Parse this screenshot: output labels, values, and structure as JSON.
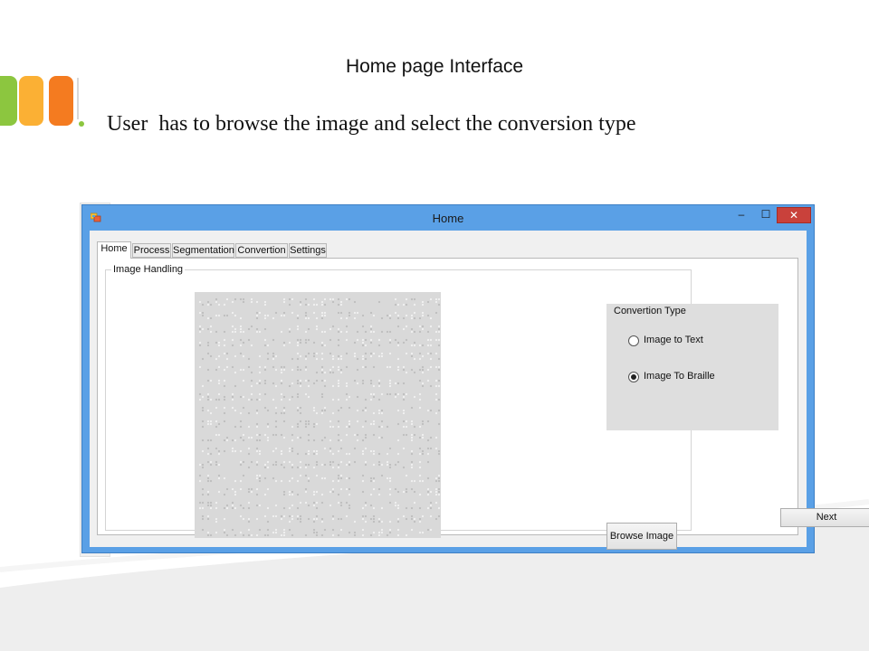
{
  "slide": {
    "title": "Home page Interface",
    "bullet": "User  has to browse the image and select the conversion type"
  },
  "window": {
    "title": "Home",
    "controls": {
      "minimize": "–",
      "maximize": "☐",
      "close": "✕"
    }
  },
  "tabs": [
    {
      "label": "Home",
      "active": true
    },
    {
      "label": "Process"
    },
    {
      "label": "Segmentation"
    },
    {
      "label": "Convertion"
    },
    {
      "label": "Settings"
    }
  ],
  "image_handling": {
    "label": "Image Handling"
  },
  "conversion": {
    "label": "Convertion Type",
    "options": [
      {
        "label": "Image to Text",
        "checked": false
      },
      {
        "label": "Image To Braille",
        "checked": true
      }
    ]
  },
  "buttons": {
    "browse": "Browse Image",
    "next": "Next"
  },
  "colors": {
    "green": "#8cc63f",
    "yellow": "#fbb034",
    "orange": "#f47b20",
    "window_frame": "#5aa0e6",
    "close_button": "#c9413b"
  },
  "icons": {
    "app": "app-icon",
    "radio": "radio-icon"
  }
}
